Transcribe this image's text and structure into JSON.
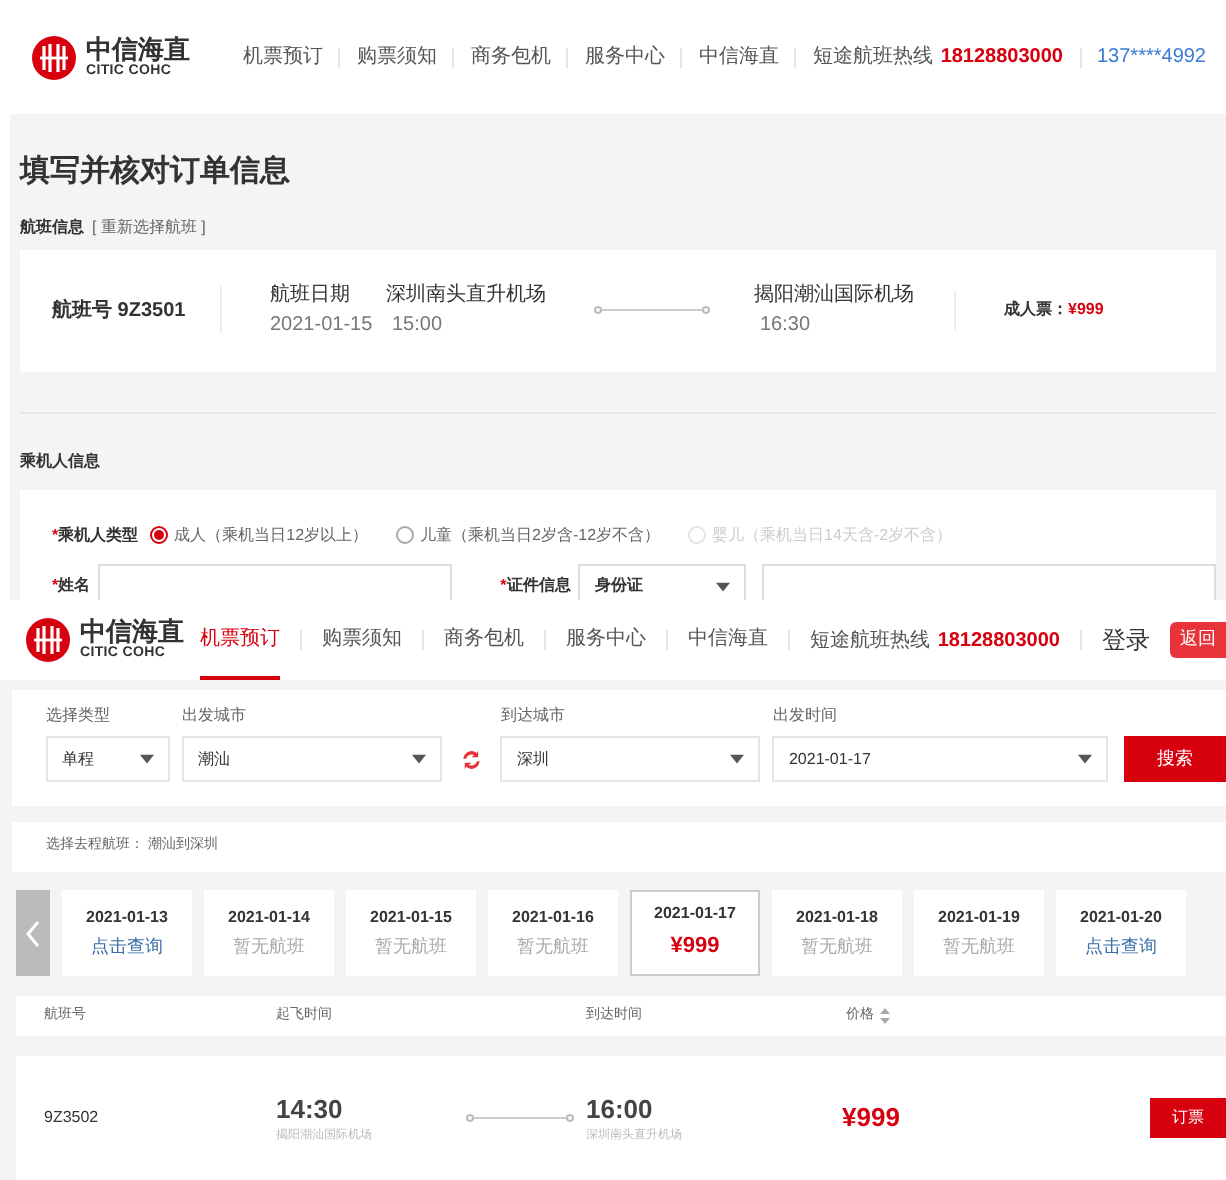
{
  "booking_page": {
    "logo": {
      "name": "中信海直",
      "subtitle": "CITIC COHC"
    },
    "nav": [
      {
        "label": "机票预订"
      },
      {
        "label": "购票须知"
      },
      {
        "label": "商务包机"
      },
      {
        "label": "服务中心"
      },
      {
        "label": "中信海直"
      }
    ],
    "hotline": {
      "label": "短途航班热线",
      "number": "18128803000"
    },
    "user": "137****4992",
    "title": "填写并核对订单信息",
    "flight_section": {
      "label": "航班信息",
      "link": "[ 重新选择航班 ]"
    },
    "flight": {
      "number": "航班号 9Z3501",
      "date_label": "航班日期",
      "date": "2021-01-15",
      "from": "深圳南头直升机场",
      "depart": "15:00",
      "to": "揭阳潮汕国际机场",
      "arrive": "16:30",
      "price_label": "成人票：",
      "price": "¥999"
    },
    "passenger_section": "乘机人信息",
    "passenger_type": {
      "required_mark": "*",
      "label": "乘机人类型",
      "options": [
        {
          "label": "成人（乘机当日12岁以上）",
          "selected": true,
          "disabled": false
        },
        {
          "label": "儿童（乘机当日2岁含-12岁不含）",
          "selected": false,
          "disabled": false
        },
        {
          "label": "婴儿（乘机当日14天含-2岁不含）",
          "selected": false,
          "disabled": true
        }
      ]
    },
    "name_field": {
      "required_mark": "*",
      "label": "姓名"
    },
    "id_field": {
      "required_mark": "*",
      "label": "证件信息",
      "type": "身份证"
    }
  },
  "search_page": {
    "logo": {
      "name": "中信海直",
      "subtitle": "CITIC COHC"
    },
    "nav": [
      {
        "label": "机票预订",
        "selected": true
      },
      {
        "label": "购票须知",
        "selected": false
      },
      {
        "label": "商务包机",
        "selected": false
      },
      {
        "label": "服务中心",
        "selected": false
      },
      {
        "label": "中信海直",
        "selected": false
      }
    ],
    "hotline": {
      "label": "短途航班热线",
      "number": "18128803000"
    },
    "login": "登录",
    "back_button": "返回",
    "search": {
      "type_label": "选择类型",
      "type": "单程",
      "from_label": "出发城市",
      "from": "潮汕",
      "to_label": "到达城市",
      "to": "深圳",
      "date_label": "出发时间",
      "date": "2021-01-17",
      "button": "搜索"
    },
    "route": {
      "label": "选择去程航班：",
      "value": "潮汕到深圳"
    },
    "dates": [
      {
        "date": "2021-01-13",
        "note": "点击查询",
        "kind": "query",
        "selected": false
      },
      {
        "date": "2021-01-14",
        "note": "暂无航班",
        "kind": "none",
        "selected": false
      },
      {
        "date": "2021-01-15",
        "note": "暂无航班",
        "kind": "none",
        "selected": false
      },
      {
        "date": "2021-01-16",
        "note": "暂无航班",
        "kind": "none",
        "selected": false
      },
      {
        "date": "2021-01-17",
        "note": "¥999",
        "kind": "price",
        "selected": true
      },
      {
        "date": "2021-01-18",
        "note": "暂无航班",
        "kind": "none",
        "selected": false
      },
      {
        "date": "2021-01-19",
        "note": "暂无航班",
        "kind": "none",
        "selected": false
      },
      {
        "date": "2021-01-20",
        "note": "点击查询",
        "kind": "query",
        "selected": false
      }
    ],
    "table": {
      "columns": [
        "航班号",
        "起飞时间",
        "到达时间",
        "价格"
      ],
      "rows": [
        {
          "number": "9Z3502",
          "depart": "14:30",
          "from": "揭阳潮汕国际机场",
          "arrive": "16:00",
          "to": "深圳南头直升机场",
          "price": "¥999",
          "button": "订票"
        }
      ]
    }
  }
}
